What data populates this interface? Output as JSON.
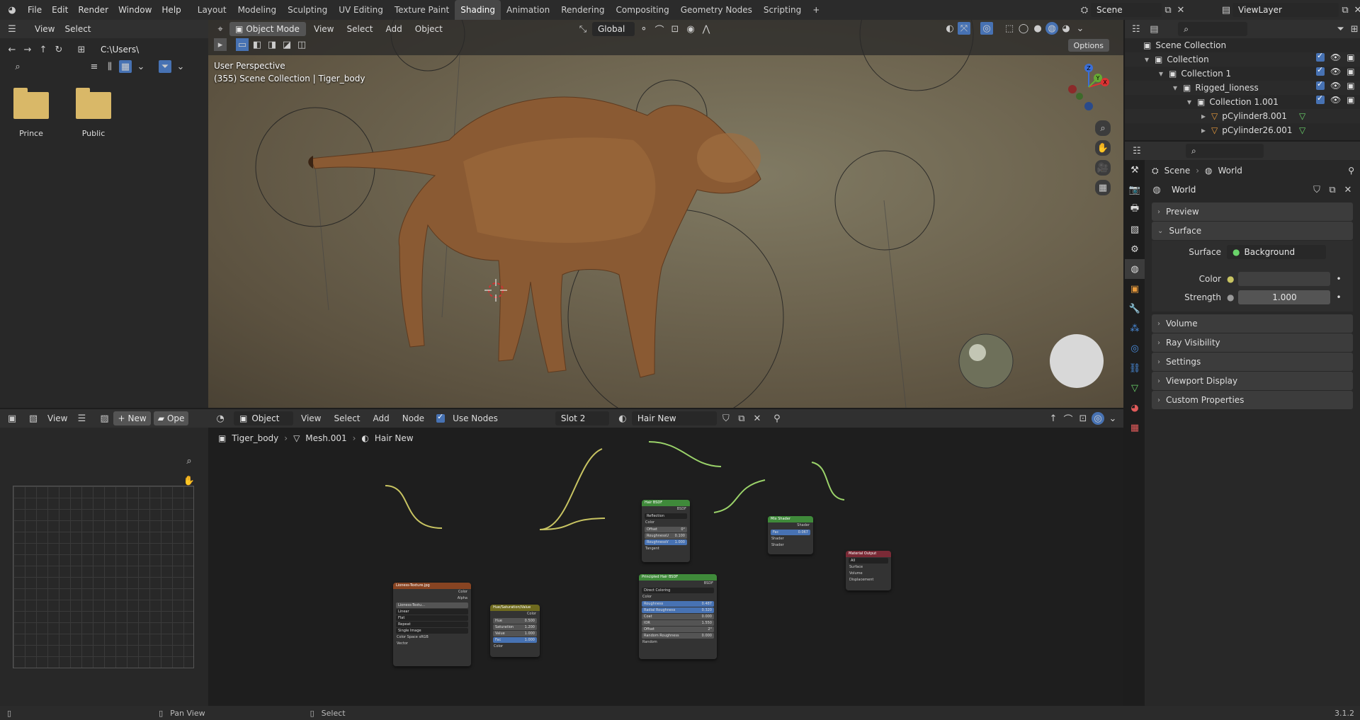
{
  "app": {
    "logo": "blender-logo"
  },
  "menus": [
    "File",
    "Edit",
    "Render",
    "Window",
    "Help"
  ],
  "workspace_tabs": [
    {
      "label": "Layout",
      "active": false
    },
    {
      "label": "Modeling",
      "active": false
    },
    {
      "label": "Sculpting",
      "active": false
    },
    {
      "label": "UV Editing",
      "active": false
    },
    {
      "label": "Texture Paint",
      "active": false
    },
    {
      "label": "Shading",
      "active": true
    },
    {
      "label": "Animation",
      "active": false
    },
    {
      "label": "Rendering",
      "active": false
    },
    {
      "label": "Compositing",
      "active": false
    },
    {
      "label": "Geometry Nodes",
      "active": false
    },
    {
      "label": "Scripting",
      "active": false
    }
  ],
  "scene": {
    "name": "Scene",
    "view_layer": "ViewLayer"
  },
  "file_browser": {
    "menus": [
      "View",
      "Select"
    ],
    "path": "C:\\Users\\",
    "items": [
      "Prince",
      "Public"
    ]
  },
  "viewport": {
    "mode": "Object Mode",
    "menus": [
      "View",
      "Select",
      "Add",
      "Object"
    ],
    "transform": "Global",
    "options_label": "Options",
    "overlay_line1": "User Perspective",
    "overlay_line2": "(355) Scene Collection | Tiger_body",
    "gizmo_axes": [
      "Z",
      "Y",
      "X"
    ]
  },
  "image_editor": {
    "view_label": "View",
    "new_label": "New",
    "open_label": "Ope"
  },
  "node_editor": {
    "object_label": "Object",
    "menus": [
      "View",
      "Select",
      "Add",
      "Node"
    ],
    "use_nodes": "Use Nodes",
    "slot": "Slot 2",
    "material": "Hair New",
    "breadcrumb": [
      "Tiger_body",
      "Mesh.001",
      "Hair New"
    ],
    "nodes": {
      "image": {
        "title": "Lioness-Texture.jpg",
        "outputs": [
          "Color",
          "Alpha"
        ],
        "fields": [
          "Lioness-Textu...",
          "Linear",
          "Flat",
          "Repeat",
          "Single Image",
          "Color Space  sRGB"
        ],
        "inputs": [
          "Vector"
        ]
      },
      "hsv": {
        "title": "Hue/Saturation/Value",
        "output": "Color",
        "fields": [
          [
            "Hue",
            "0.500"
          ],
          [
            "Saturation",
            "1.200"
          ],
          [
            "Value",
            "1.000"
          ],
          [
            "Fac",
            "1.000"
          ]
        ],
        "input": "Color"
      },
      "hair": {
        "title": "Hair BSDF",
        "output": "BSDF",
        "mode": "Reflection",
        "color": "Color",
        "fields": [
          [
            "Offset",
            "0°"
          ],
          [
            "RoughnessU",
            "0.100"
          ],
          [
            "RoughnessV",
            "1.000"
          ]
        ],
        "tangent": "Tangent"
      },
      "phair": {
        "title": "Principled Hair BSDF",
        "output": "BSDF",
        "mode": "Direct Coloring",
        "color": "Color",
        "fields": [
          [
            "Roughness",
            "0.487"
          ],
          [
            "Radial Roughness",
            "0.320"
          ],
          [
            "Coat",
            "0.000"
          ],
          [
            "IOR",
            "1.550"
          ],
          [
            "Offset",
            "2°"
          ],
          [
            "Random Roughness",
            "0.000"
          ]
        ],
        "random": "Random"
      },
      "mix": {
        "title": "Mix Shader",
        "output": "Shader",
        "fac": [
          "Fac",
          "0.067"
        ],
        "inputs": [
          "Shader",
          "Shader"
        ]
      },
      "output": {
        "title": "Material Output",
        "target": "All",
        "inputs": [
          "Surface",
          "Volume",
          "Displacement"
        ]
      }
    }
  },
  "outliner": {
    "root": "Scene Collection",
    "rows": [
      {
        "label": "Collection",
        "indent": 1
      },
      {
        "label": "Collection 1",
        "indent": 2
      },
      {
        "label": "Rigged_lioness",
        "indent": 3
      },
      {
        "label": "Collection 1.001",
        "indent": 4
      },
      {
        "label": "pCylinder8.001",
        "indent": 5
      },
      {
        "label": "pCylinder26.001",
        "indent": 5
      }
    ]
  },
  "properties": {
    "breadcrumb": [
      "Scene",
      "World"
    ],
    "world_name": "World",
    "sections": {
      "preview": "Preview",
      "surface": "Surface",
      "volume": "Volume",
      "ray_visibility": "Ray Visibility",
      "settings": "Settings",
      "viewport_display": "Viewport Display",
      "custom_properties": "Custom Properties"
    },
    "surface_label": "Surface",
    "surface_value": "Background",
    "color_label": "Color",
    "strength_label": "Strength",
    "strength_value": "1.000"
  },
  "status": {
    "pan": "Pan View",
    "select": "Select",
    "version": "3.1.2"
  },
  "colors": {
    "accent": "#4772b3",
    "header": "#303030",
    "node_wire": "#9bd36a",
    "node_wire_color": "#c8c462"
  }
}
